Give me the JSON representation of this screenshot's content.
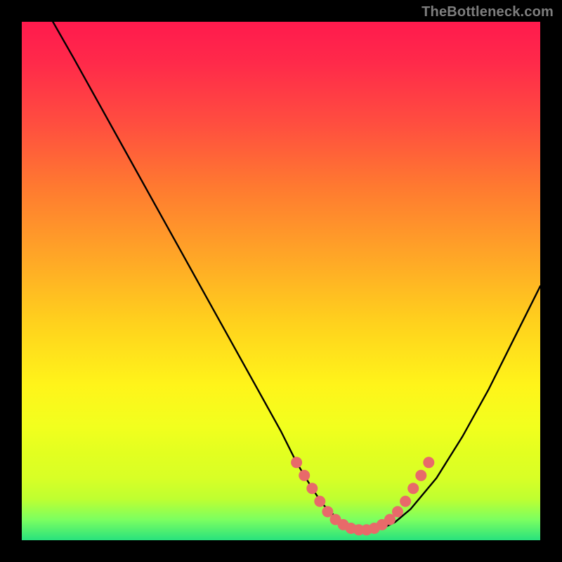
{
  "watermark": {
    "text": "TheBottleneck.com"
  },
  "chart_data": {
    "type": "line",
    "title": "",
    "xlabel": "",
    "ylabel": "",
    "xlim": [
      0,
      100
    ],
    "ylim": [
      0,
      100
    ],
    "series": [
      {
        "name": "bottleneck-curve",
        "stroke": "#000000",
        "x": [
          6,
          10,
          15,
          20,
          25,
          30,
          35,
          40,
          45,
          50,
          53,
          56,
          58,
          60,
          62,
          64,
          66,
          68,
          70,
          72,
          75,
          80,
          85,
          90,
          95,
          100
        ],
        "y": [
          100,
          93,
          84,
          75,
          66,
          57,
          48,
          39,
          30,
          21,
          15,
          10,
          7,
          5,
          3.5,
          2.5,
          2,
          2,
          2.5,
          3.5,
          6,
          12,
          20,
          29,
          39,
          49
        ]
      }
    ],
    "markers": {
      "name": "highlight-beads",
      "color": "#e86a6a",
      "radius_px": 8,
      "points": [
        {
          "x": 53.0,
          "y": 15.0
        },
        {
          "x": 54.5,
          "y": 12.5
        },
        {
          "x": 56.0,
          "y": 10.0
        },
        {
          "x": 57.5,
          "y": 7.5
        },
        {
          "x": 59.0,
          "y": 5.5
        },
        {
          "x": 60.5,
          "y": 4.0
        },
        {
          "x": 62.0,
          "y": 3.0
        },
        {
          "x": 63.5,
          "y": 2.3
        },
        {
          "x": 65.0,
          "y": 2.0
        },
        {
          "x": 66.5,
          "y": 2.0
        },
        {
          "x": 68.0,
          "y": 2.3
        },
        {
          "x": 69.5,
          "y": 3.0
        },
        {
          "x": 71.0,
          "y": 4.0
        },
        {
          "x": 72.5,
          "y": 5.5
        },
        {
          "x": 74.0,
          "y": 7.5
        },
        {
          "x": 75.5,
          "y": 10.0
        },
        {
          "x": 77.0,
          "y": 12.5
        },
        {
          "x": 78.5,
          "y": 15.0
        }
      ]
    }
  }
}
